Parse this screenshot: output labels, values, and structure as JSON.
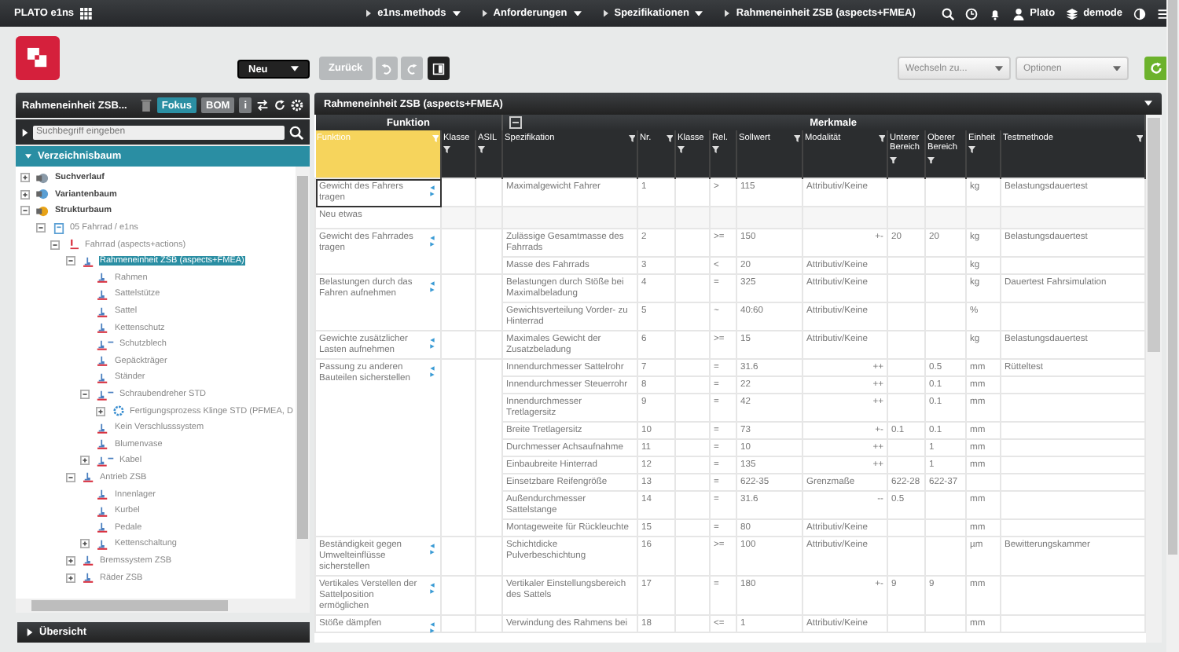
{
  "topbar": {
    "brand": "PLATO e1ns",
    "breadcrumbs": [
      {
        "label": "e1ns.methods",
        "dropdown": true
      },
      {
        "label": "Anforderungen",
        "dropdown": true
      },
      {
        "label": "Spezifikationen",
        "dropdown": true
      },
      {
        "label": "Rahmeneinheit ZSB (aspects+FMEA)",
        "dropdown": false
      }
    ],
    "user": "Plato",
    "workspace": "demode"
  },
  "toolbar": {
    "new_button": "Neu",
    "back_button": "Zurück",
    "switch_select": "Wechseln zu...",
    "options_select": "Optionen"
  },
  "left_panel": {
    "title": "Rahmeneinheit ZSB...",
    "tabs": [
      {
        "label": "Fokus",
        "selected": true
      },
      {
        "label": "BOM",
        "selected": false
      }
    ],
    "info_button": "i",
    "search": {
      "placeholder": "Suchbegriff eingeben"
    },
    "tree_title": "Verzeichnisbaum",
    "footer_title": "Übersicht",
    "tree": [
      {
        "label": "Suchverlauf",
        "kind": "history",
        "bold": true,
        "expanded": false,
        "selected": false
      },
      {
        "label": "Variantenbaum",
        "kind": "variant",
        "bold": true,
        "expanded": false,
        "selected": false
      },
      {
        "label": "Strukturbaum",
        "kind": "structure",
        "bold": true,
        "expanded": true,
        "selected": false,
        "children": [
          {
            "label": "05 Fahrrad / e1ns",
            "kind": "document",
            "bold": false,
            "expanded": true,
            "selected": false,
            "children": [
              {
                "label": "Fahrrad (aspects+actions)",
                "kind": "system",
                "bold": false,
                "expanded": true,
                "selected": false,
                "children": [
                  {
                    "label": "Rahmeneinheit ZSB (aspects+FMEA)",
                    "kind": "part",
                    "bold": false,
                    "expanded": true,
                    "selected": true,
                    "children": [
                      {
                        "label": "Rahmen",
                        "kind": "part",
                        "bold": false,
                        "selected": false
                      },
                      {
                        "label": "Sattelstütze",
                        "kind": "part",
                        "bold": false,
                        "selected": false
                      },
                      {
                        "label": "Sattel",
                        "kind": "part",
                        "bold": false,
                        "selected": false
                      },
                      {
                        "label": "Kettenschutz",
                        "kind": "part",
                        "bold": false,
                        "selected": false
                      },
                      {
                        "label": "Schutzblech",
                        "kind": "variant-part",
                        "bold": false,
                        "selected": false
                      },
                      {
                        "label": "Gepäckträger",
                        "kind": "part",
                        "bold": false,
                        "selected": false
                      },
                      {
                        "label": "Ständer",
                        "kind": "part",
                        "bold": false,
                        "selected": false
                      },
                      {
                        "label": "Schraubendreher STD",
                        "kind": "variant-part",
                        "bold": false,
                        "expanded": true,
                        "selected": false,
                        "children": [
                          {
                            "label": "Fertigungsprozess Klinge STD (PFMEA, D",
                            "kind": "process",
                            "bold": false,
                            "expanded": false,
                            "selected": false
                          }
                        ]
                      },
                      {
                        "label": "Kein Verschlusssystem",
                        "kind": "part",
                        "bold": false,
                        "selected": false
                      },
                      {
                        "label": "Blumenvase",
                        "kind": "part",
                        "bold": false,
                        "selected": false
                      },
                      {
                        "label": "Kabel",
                        "kind": "variant-part",
                        "bold": false,
                        "expanded": false,
                        "selected": false
                      }
                    ]
                  },
                  {
                    "label": "Antrieb ZSB",
                    "kind": "part",
                    "bold": false,
                    "expanded": true,
                    "selected": false,
                    "children": [
                      {
                        "label": "Innenlager",
                        "kind": "part",
                        "bold": false,
                        "selected": false
                      },
                      {
                        "label": "Kurbel",
                        "kind": "part",
                        "bold": false,
                        "selected": false
                      },
                      {
                        "label": "Pedale",
                        "kind": "part",
                        "bold": false,
                        "selected": false
                      },
                      {
                        "label": "Kettenschaltung",
                        "kind": "part",
                        "bold": false,
                        "expanded": false,
                        "selected": false
                      }
                    ]
                  },
                  {
                    "label": "Bremssystem ZSB",
                    "kind": "part",
                    "bold": false,
                    "expanded": false,
                    "selected": false
                  },
                  {
                    "label": "Räder ZSB",
                    "kind": "part",
                    "bold": false,
                    "expanded": false,
                    "selected": false
                  }
                ]
              }
            ]
          }
        ]
      }
    ]
  },
  "table": {
    "title": "Rahmeneinheit ZSB (aspects+FMEA)",
    "groups": [
      {
        "label": "Funktion",
        "columns": [
          {
            "label": "Funktion",
            "selected": true
          },
          {
            "label": "Klasse",
            "selected": false
          },
          {
            "label": "ASIL",
            "selected": false
          }
        ]
      },
      {
        "label": "Merkmale",
        "columns": [
          {
            "label": "Spezifikation",
            "selected": false
          },
          {
            "label": "Nr.",
            "selected": false
          },
          {
            "label": "Klasse",
            "selected": false
          },
          {
            "label": "Rel.",
            "selected": false
          },
          {
            "label": "Sollwert",
            "selected": false
          },
          {
            "label": "Modalität",
            "selected": false
          },
          {
            "label": "Unterer Bereich",
            "selected": false
          },
          {
            "label": "Oberer Bereich",
            "selected": false
          },
          {
            "label": "Einheit",
            "selected": false
          },
          {
            "label": "Testmethode",
            "selected": false
          }
        ]
      }
    ],
    "rows": [
      {
        "funktion": "Gewicht des Fahrers tragen",
        "selected": true,
        "specs": [
          {
            "spezifikation": "Maximalgewicht Fahrer",
            "nr": "1",
            "rel": ">",
            "sollwert": "115",
            "modalitaet": "Attributiv/Keine",
            "einheit": "kg",
            "testmethode": "Belastungsdauertest"
          }
        ]
      },
      {
        "funktion": "Neu etwas",
        "selected": false,
        "specs": []
      },
      {
        "funktion": "Gewicht des Fahrrades tragen",
        "selected": false,
        "specs": [
          {
            "spezifikation": "Zulässige Gesamtmasse des Fahrrads",
            "nr": "2",
            "rel": ">=",
            "sollwert": "150",
            "modalitaet": "+-",
            "unterer": "20",
            "oberer": "20",
            "einheit": "kg",
            "testmethode": "Belastungsdauertest"
          },
          {
            "spezifikation": "Masse des Fahrrads",
            "nr": "3",
            "rel": "<",
            "sollwert": "20",
            "modalitaet": "Attributiv/Keine",
            "einheit": "kg"
          }
        ]
      },
      {
        "funktion": "Belastungen durch das Fahren aufnehmen",
        "selected": false,
        "specs": [
          {
            "spezifikation": "Belastungen durch Stöße bei Maximalbeladung",
            "nr": "4",
            "rel": "=",
            "sollwert": "325",
            "modalitaet": "Attributiv/Keine",
            "einheit": "kg",
            "testmethode": "Dauertest Fahrsimulation"
          },
          {
            "spezifikation": "Gewichtsverteilung Vorder- zu Hinterrad",
            "nr": "5",
            "rel": "~",
            "sollwert": "40:60",
            "modalitaet": "Attributiv/Keine",
            "einheit": "%"
          }
        ]
      },
      {
        "funktion": "Gewichte zusätzlicher Lasten aufnehmen",
        "selected": false,
        "specs": [
          {
            "spezifikation": "Maximales Gewicht der Zusatzbeladung",
            "nr": "6",
            "rel": ">=",
            "sollwert": "15",
            "modalitaet": "Attributiv/Keine",
            "einheit": "kg",
            "testmethode": "Belastungsdauertest"
          }
        ]
      },
      {
        "funktion": "Passung zu anderen Bauteilen sicherstellen",
        "selected": false,
        "specs": [
          {
            "spezifikation": "Innendurchmesser Sattelrohr",
            "nr": "7",
            "rel": "=",
            "sollwert": "31.6",
            "modalitaet": "++",
            "oberer": "0.5",
            "einheit": "mm",
            "testmethode": "Rütteltest"
          },
          {
            "spezifikation": "Innendurchmesser Steuerrohr",
            "nr": "8",
            "rel": "=",
            "sollwert": "22",
            "modalitaet": "++",
            "oberer": "0.1",
            "einheit": "mm"
          },
          {
            "spezifikation": "Innendurchmesser Tretlagersitz",
            "nr": "9",
            "rel": "=",
            "sollwert": "42",
            "modalitaet": "++",
            "oberer": "0.1",
            "einheit": "mm"
          },
          {
            "spezifikation": "Breite Tretlagersitz",
            "nr": "10",
            "rel": "=",
            "sollwert": "73",
            "modalitaet": "+-",
            "unterer": "0.1",
            "oberer": "0.1",
            "einheit": "mm"
          },
          {
            "spezifikation": "Durchmesser Achsaufnahme",
            "nr": "11",
            "rel": "=",
            "sollwert": "10",
            "modalitaet": "++",
            "oberer": "1",
            "einheit": "mm"
          },
          {
            "spezifikation": "Einbaubreite Hinterrad",
            "nr": "12",
            "rel": "=",
            "sollwert": "135",
            "modalitaet": "++",
            "oberer": "1",
            "einheit": "mm"
          },
          {
            "spezifikation": "Einsetzbare Reifengröße",
            "nr": "13",
            "rel": "=",
            "sollwert": "622-35",
            "modalitaet": "Grenzmaße",
            "unterer": "622-28",
            "oberer": "622-37"
          },
          {
            "spezifikation": "Außendurchmesser Sattelstange",
            "nr": "14",
            "rel": "=",
            "sollwert": "31.6",
            "modalitaet": "--",
            "unterer": "0.5",
            "einheit": "mm"
          },
          {
            "spezifikation": "Montageweite für Rückleuchte",
            "nr": "15",
            "rel": "=",
            "sollwert": "80",
            "modalitaet": "Attributiv/Keine",
            "einheit": "mm"
          }
        ]
      },
      {
        "funktion": "Beständigkeit gegen Umwelteinflüsse sicherstellen",
        "selected": false,
        "specs": [
          {
            "spezifikation": "Schichtdicke Pulverbeschichtung",
            "nr": "16",
            "rel": ">=",
            "sollwert": "100",
            "modalitaet": "Attributiv/Keine",
            "einheit": "µm",
            "testmethode": "Bewitterungskammer"
          }
        ]
      },
      {
        "funktion": "Vertikales Verstellen der Sattelposition ermöglichen",
        "selected": false,
        "specs": [
          {
            "spezifikation": "Vertikaler Einstellungsbereich des Sattels",
            "nr": "17",
            "rel": "=",
            "sollwert": "180",
            "modalitaet": "+-",
            "unterer": "9",
            "oberer": "9",
            "einheit": "mm"
          }
        ]
      },
      {
        "funktion": "Stöße dämpfen",
        "selected": false,
        "specs": [
          {
            "spezifikation": "Verwindung des Rahmens bei",
            "nr": "18",
            "rel": "<=",
            "sollwert": "1",
            "modalitaet": "Attributiv/Keine",
            "einheit": "mm"
          }
        ]
      }
    ]
  }
}
